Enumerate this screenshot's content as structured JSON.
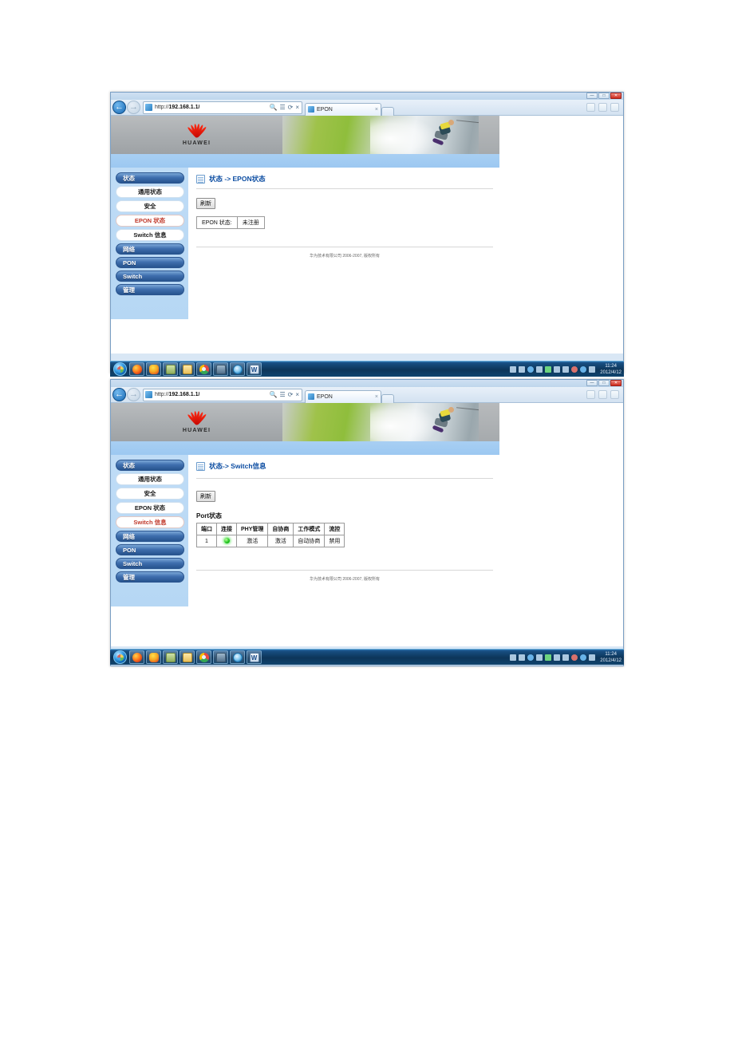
{
  "browser": {
    "url_prefix": "http://",
    "url_host": "192.168.1.1/",
    "tab_title": "EPON",
    "tab_close": "×",
    "back_arrow": "←",
    "forward_arrow": "→",
    "search_icon": "search-icon",
    "stop_icon": "×",
    "refresh_icon": "⟳",
    "minimize": "—",
    "maximize": "□",
    "close": "✕"
  },
  "banner": {
    "brand": "HUAWEI",
    "logo_name": "huawei-flower-logo"
  },
  "sidebar": {
    "groups": [
      {
        "header": "状态",
        "items": [
          {
            "label": "通用状态",
            "active_win1": false,
            "active_win2": false
          },
          {
            "label": "安全",
            "active_win1": false,
            "active_win2": false
          },
          {
            "label": "EPON 状态",
            "active_win1": true,
            "active_win2": false
          },
          {
            "label": "Switch 信息",
            "active_win1": false,
            "active_win2": true
          }
        ]
      },
      {
        "header": "网络",
        "items": []
      },
      {
        "header": "PON",
        "items": []
      },
      {
        "header": "Switch",
        "items": []
      },
      {
        "header": "管理",
        "items": []
      }
    ]
  },
  "window1": {
    "breadcrumb": "状态 -> EPON状态",
    "refresh_button": "刷新",
    "status_label": "EPON 状态:",
    "status_value": "未注册"
  },
  "window2": {
    "breadcrumb": "状态-> Switch信息",
    "refresh_button": "刷新",
    "section_title": "Port状态",
    "table": {
      "headers": [
        "端口",
        "连接",
        "PHY管理",
        "自协商",
        "工作模式",
        "流控"
      ],
      "rows": [
        {
          "port": "1",
          "link": "green-led-icon",
          "phy": "激活",
          "autoneg": "激活",
          "mode": "自动协商",
          "flow": "禁用"
        }
      ]
    }
  },
  "footer": {
    "text": "华为技术有限公司 2006-2007, 版权所有"
  },
  "taskbar": {
    "start_name": "windows-start-orb",
    "icons": [
      "firefox-icon",
      "qq-icon",
      "folder-icon",
      "explorer-icon",
      "chrome-icon",
      "media-player-icon",
      "internet-explorer-icon",
      "word-icon"
    ],
    "clock_time": "11:24",
    "clock_date": "2012/4/12"
  },
  "colors": {
    "accent_blue": "#0c4da2",
    "active_red": "#c0392b",
    "menu_blue": "#27548f",
    "sidebar_bg": "#b6d7f4",
    "led_green": "#19c219"
  }
}
